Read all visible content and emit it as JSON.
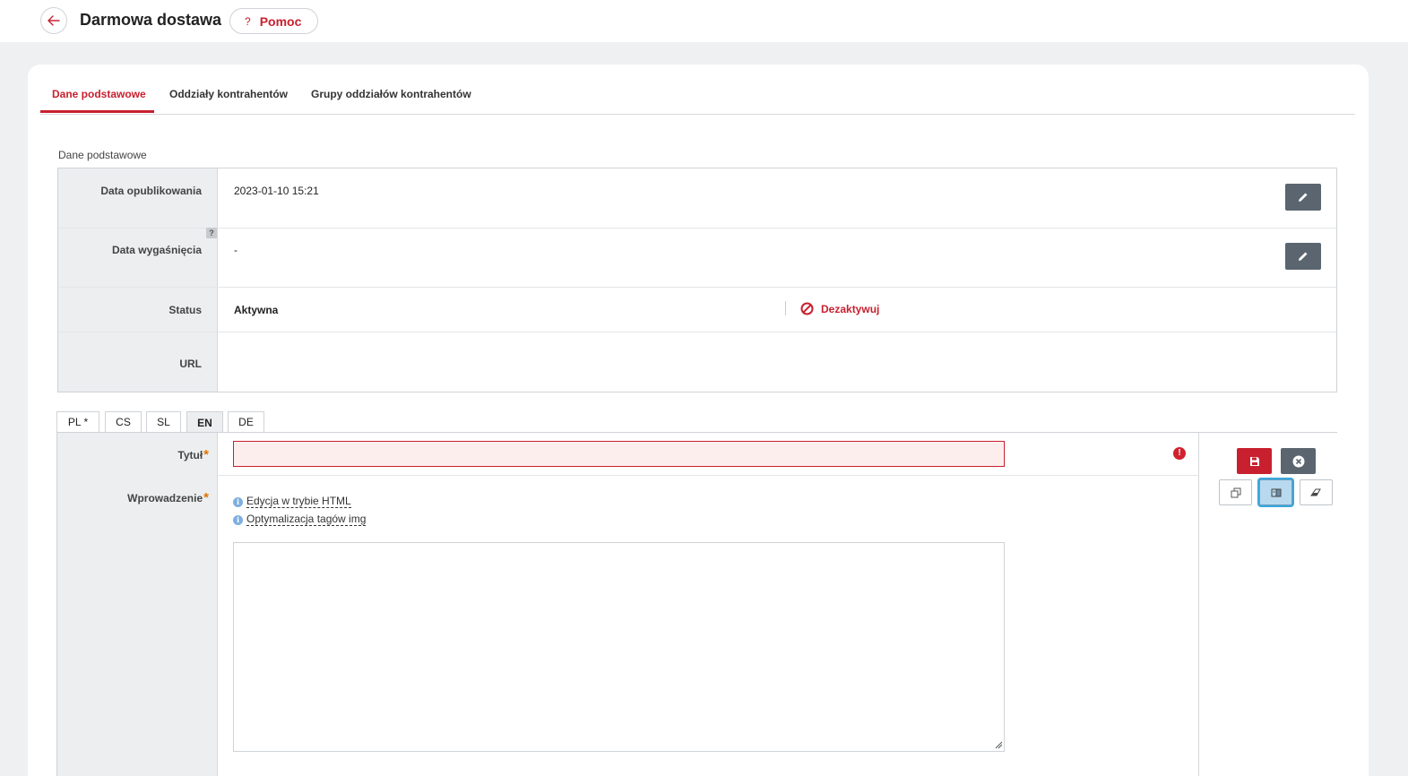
{
  "header": {
    "title": "Darmowa dostawa",
    "help_label": "Pomoc",
    "help_icon": "?"
  },
  "tabs": [
    {
      "label": "Dane podstawowe",
      "active": true
    },
    {
      "label": "Oddziały kontrahentów",
      "active": false
    },
    {
      "label": "Grupy oddziałów kontrahentów",
      "active": false
    }
  ],
  "section_label": "Dane podstawowe",
  "properties": {
    "published": {
      "label": "Data opublikowania",
      "value": "2023-01-10 15:21"
    },
    "expires": {
      "label": "Data wygaśnięcia",
      "value": "-",
      "hint": "?"
    },
    "status": {
      "label": "Status",
      "value": "Aktywna",
      "action_label": "Dezaktywuj"
    },
    "url": {
      "label": "URL",
      "value": ""
    }
  },
  "languages": [
    {
      "code": "PL *",
      "active": false
    },
    {
      "code": "CS",
      "active": false
    },
    {
      "code": "SL",
      "active": false
    },
    {
      "code": "EN",
      "active": true
    },
    {
      "code": "DE",
      "active": false
    }
  ],
  "form": {
    "title_label": "Tytuł",
    "title_value": "",
    "title_error_icon": "!",
    "intro_label": "Wprowadzenie",
    "required_mark": "*",
    "links": [
      "Edycja w trybie HTML",
      "Optymalizacja tagów img"
    ],
    "info_icon": "i",
    "intro_value": ""
  },
  "colors": {
    "accent": "#c8202f",
    "dark_button": "#5b6570",
    "focus_ring": "#3aa7dc"
  },
  "icons": {
    "back": "arrow-left-icon",
    "edit": "pencil-icon",
    "deactivate": "ban-icon",
    "save": "floppy-disk-icon",
    "cancel": "close-circle-icon",
    "copy": "copy-icon",
    "translate": "translate-icon",
    "clear": "eraser-icon"
  }
}
